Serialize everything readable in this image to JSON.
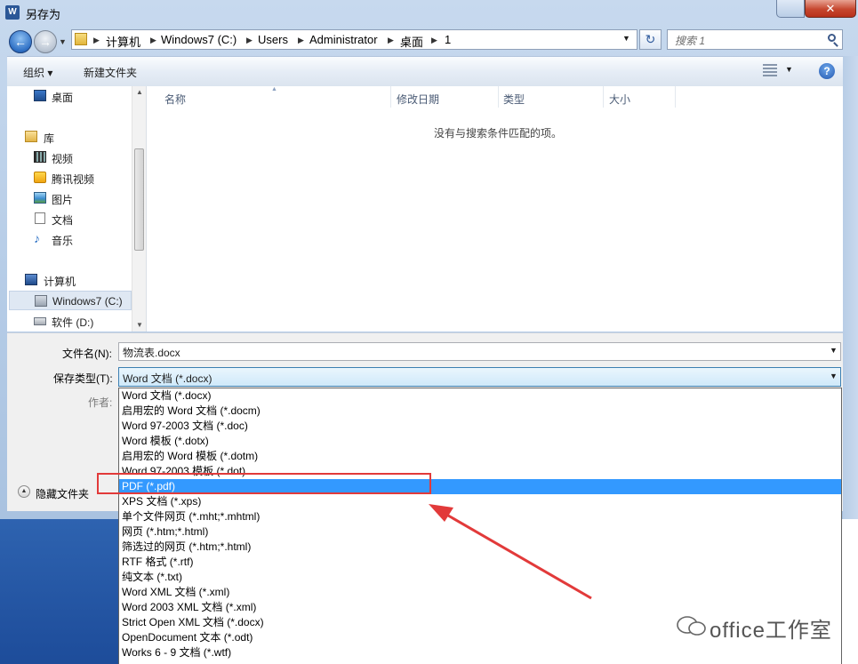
{
  "window": {
    "title": "另存为",
    "app_icon_letter": "W",
    "close_glyph": "✕"
  },
  "nav": {
    "back_glyph": "←",
    "forward_glyph": "→",
    "breadcrumb": [
      "计算机",
      "Windows7 (C:)",
      "Users",
      "Administrator",
      "桌面",
      "1"
    ],
    "refresh_glyph": "↻",
    "search_placeholder": "搜索 1"
  },
  "toolbar": {
    "organize_label": "组织 ▾",
    "new_folder_label": "新建文件夹",
    "help_glyph": "?"
  },
  "navpane": {
    "items": [
      {
        "label": "桌面",
        "icon": "desktop-icon"
      },
      {
        "label": "库",
        "icon": "library-icon"
      },
      {
        "label": "视频",
        "icon": "video-icon"
      },
      {
        "label": "腾讯视频",
        "icon": "tencent-video-icon"
      },
      {
        "label": "图片",
        "icon": "picture-icon"
      },
      {
        "label": "文档",
        "icon": "document-icon"
      },
      {
        "label": "音乐",
        "icon": "music-icon"
      },
      {
        "label": "计算机",
        "icon": "computer-icon"
      },
      {
        "label": "Windows7 (C:)",
        "icon": "drive-c-icon",
        "selected": true
      },
      {
        "label": "软件 (D:)",
        "icon": "drive-d-icon"
      }
    ]
  },
  "filelist": {
    "columns": [
      "名称",
      "修改日期",
      "类型",
      "大小"
    ],
    "empty_message": "没有与搜索条件匹配的项。"
  },
  "form": {
    "filename_label": "文件名(N):",
    "filename_value": "物流表.docx",
    "filetype_label": "保存类型(T):",
    "filetype_value": "Word 文档 (*.docx)",
    "author_label": "作者:",
    "hide_folders_label": "隐藏文件夹"
  },
  "filetype_options": [
    "Word 文档 (*.docx)",
    "启用宏的 Word 文档 (*.docm)",
    "Word 97-2003 文档 (*.doc)",
    "Word 模板 (*.dotx)",
    "启用宏的 Word 模板 (*.dotm)",
    "Word 97-2003 模板 (*.dot)",
    "PDF (*.pdf)",
    "XPS 文档 (*.xps)",
    "单个文件网页 (*.mht;*.mhtml)",
    "网页 (*.htm;*.html)",
    "筛选过的网页 (*.htm;*.html)",
    "RTF 格式 (*.rtf)",
    "纯文本 (*.txt)",
    "Word XML 文档 (*.xml)",
    "Word 2003 XML 文档 (*.xml)",
    "Strict Open XML 文档 (*.docx)",
    "OpenDocument 文本 (*.odt)",
    "Works 6 - 9 文档 (*.wtf)"
  ],
  "selected_option": "PDF (*.pdf)",
  "watermark": {
    "text": "office工作室"
  },
  "colors": {
    "selection": "#3399ff",
    "annotation_red": "#e23a3a",
    "titlebar": "#c7d9ee"
  }
}
